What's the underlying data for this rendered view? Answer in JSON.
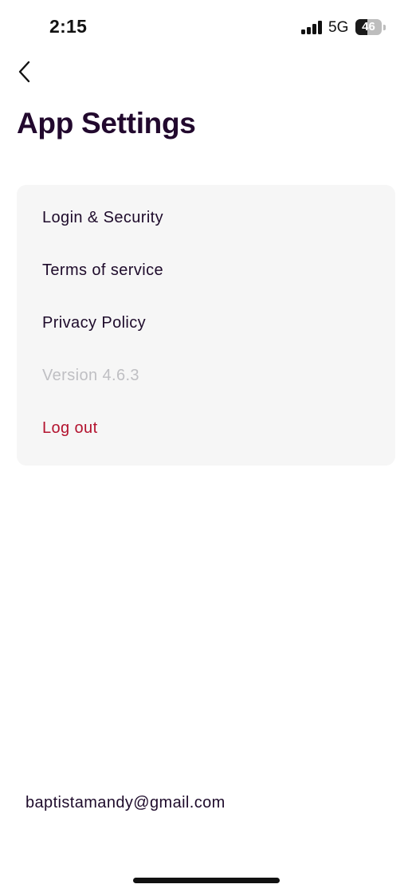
{
  "status_bar": {
    "time": "2:15",
    "network": "5G",
    "battery_level": "46",
    "battery_fraction": 0.46,
    "icons": [
      "signal-icon",
      "battery-icon"
    ]
  },
  "header": {
    "back_icon": "chevron-left-icon",
    "title": "App Settings"
  },
  "settings": {
    "items": [
      {
        "label": "Login & Security"
      },
      {
        "label": "Terms of service"
      },
      {
        "label": "Privacy Policy"
      }
    ],
    "version": "Version 4.6.3",
    "logout_label": "Log out"
  },
  "footer": {
    "email": "baptistamandy@gmail.com"
  },
  "colors": {
    "title": "#22092e",
    "text": "#1e0b2b",
    "muted": "#bfbfc3",
    "danger": "#b3122e",
    "card_background": "#f6f6f6"
  }
}
